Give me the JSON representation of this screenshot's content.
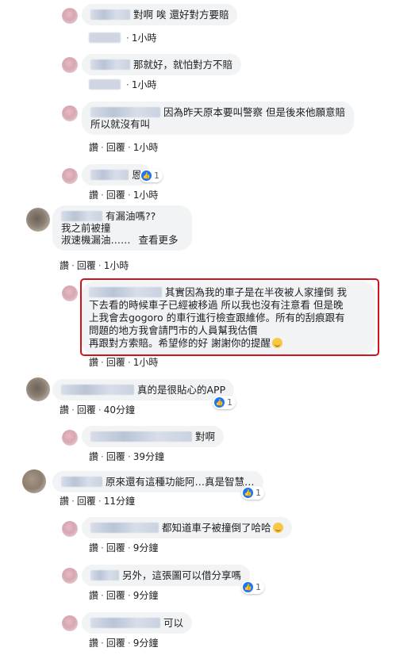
{
  "actions": {
    "like": "讚",
    "reply": "回覆",
    "sep": "·"
  },
  "comments": [
    {
      "id": "c1",
      "text": "對啊 唉 還好對方要賠",
      "time": "1小時"
    },
    {
      "id": "c2",
      "text": "那就好，就怕對方不賠",
      "time": "1小時"
    },
    {
      "id": "c3",
      "text_line1": "因為昨天原本要叫警察 但是後來他願意賠",
      "text_line2": "所以就沒有叫",
      "time": "1小時"
    },
    {
      "id": "c4",
      "text": "恩",
      "time": "1小時",
      "likes": "1"
    },
    {
      "id": "c5",
      "text_line1": "有漏油嗎??",
      "text_line2": "我之前被撞",
      "text_line3": "淑速機漏油……",
      "see_more": "查看更多",
      "time": "1小時"
    },
    {
      "id": "c6",
      "text_line1": "其實因為我的車子是在半夜被人家撞倒 我",
      "text_line2": "下去看的時候車子已經被移過 所以我也沒有注意看 但是晚",
      "text_line3": "上我會去gogoro 的車行進行檢查跟維修。所有的刮痕跟有",
      "text_line4": "問題的地方我會請門市的人員幫我估價",
      "text_line5": "再跟對方索賠。希望修的好 謝謝你的提醒",
      "time": "1小時"
    },
    {
      "id": "c7",
      "text": "真的是很貼心的APP",
      "time": "40分鐘",
      "likes": "1"
    },
    {
      "id": "c8",
      "text": "對啊",
      "time": "39分鐘"
    },
    {
      "id": "c9",
      "text": "原來還有這種功能阿…真是智慧…",
      "time": "11分鐘",
      "likes": "1"
    },
    {
      "id": "c10",
      "text": "都知道車子被撞倒了哈哈",
      "time": "9分鐘"
    },
    {
      "id": "c11",
      "text": "另外，這張圖可以借分享嗎",
      "time": "9分鐘",
      "likes": "1"
    },
    {
      "id": "c12",
      "text": "可以",
      "time": "9分鐘"
    }
  ],
  "colors": {
    "bubble": "#f2f3f5",
    "highlight": "#d0121e",
    "like_blue": "#1877f2"
  },
  "icons": {
    "like": "thumbs-up-icon",
    "smile": "smile-emoji-icon",
    "laugh": "laughing-emoji-icon"
  }
}
